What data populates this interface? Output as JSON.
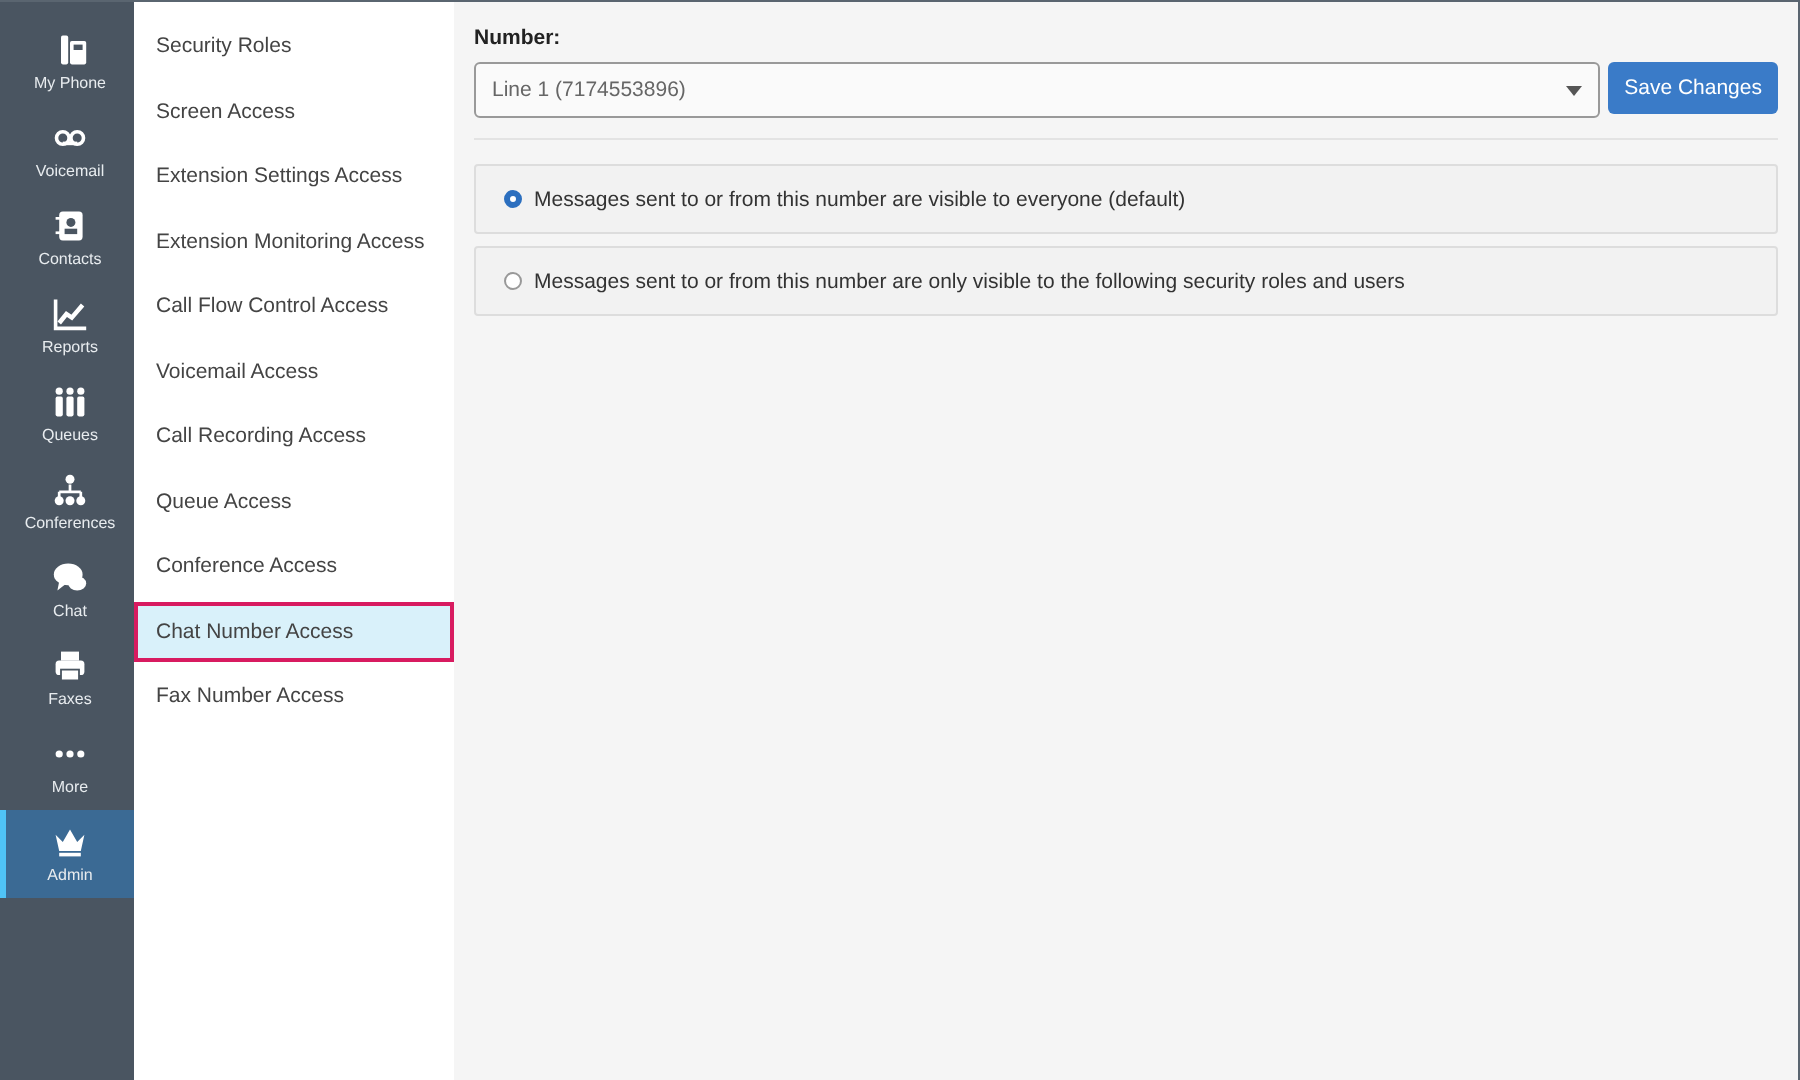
{
  "nav": [
    {
      "label": "My Phone",
      "selected": false
    },
    {
      "label": "Voicemail",
      "selected": false
    },
    {
      "label": "Contacts",
      "selected": false
    },
    {
      "label": "Reports",
      "selected": false
    },
    {
      "label": "Queues",
      "selected": false
    },
    {
      "label": "Conferences",
      "selected": false
    },
    {
      "label": "Chat",
      "selected": false
    },
    {
      "label": "Faxes",
      "selected": false
    },
    {
      "label": "More",
      "selected": false
    },
    {
      "label": "Admin",
      "selected": true
    }
  ],
  "submenu": [
    {
      "label": "Security Roles",
      "selected": false
    },
    {
      "label": "Screen Access",
      "selected": false
    },
    {
      "label": "Extension Settings Access",
      "selected": false
    },
    {
      "label": "Extension Monitoring Access",
      "selected": false
    },
    {
      "label": "Call Flow Control Access",
      "selected": false
    },
    {
      "label": "Voicemail Access",
      "selected": false
    },
    {
      "label": "Call Recording Access",
      "selected": false
    },
    {
      "label": "Queue Access",
      "selected": false
    },
    {
      "label": "Conference Access",
      "selected": false
    },
    {
      "label": "Chat Number Access",
      "selected": true
    },
    {
      "label": "Fax Number Access",
      "selected": false
    }
  ],
  "number": {
    "label": "Number:",
    "value": "Line 1 (7174553896)"
  },
  "save_button": "Save Changes",
  "options": [
    {
      "label": "Messages sent to or from this number are visible to everyone (default)",
      "selected": true
    },
    {
      "label": "Messages sent to or from this number are only visible to the following security roles and users",
      "selected": false
    }
  ]
}
